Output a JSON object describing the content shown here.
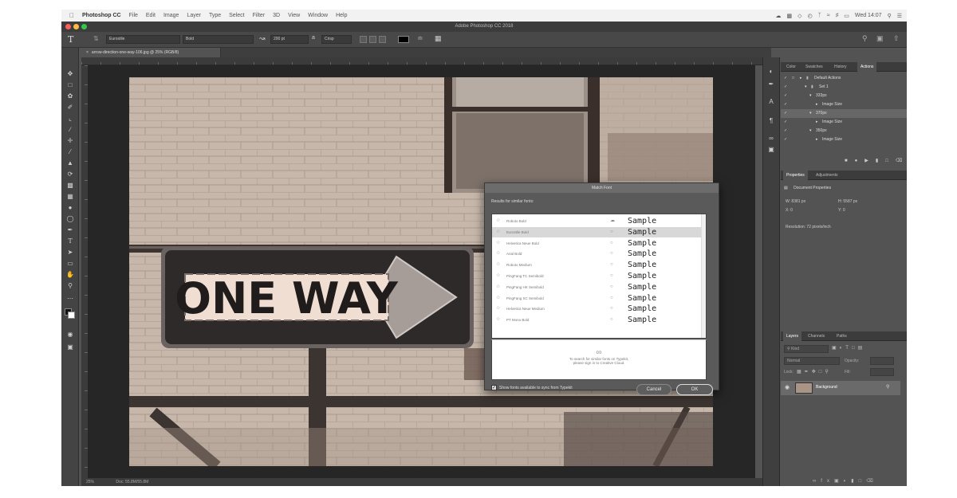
{
  "menubar": {
    "app_name": "Photoshop CC",
    "items": [
      "File",
      "Edit",
      "Image",
      "Layer",
      "Type",
      "Select",
      "Filter",
      "3D",
      "View",
      "Window",
      "Help"
    ],
    "clock": "Wed 14:07"
  },
  "window": {
    "title": "Adobe Photoshop CC 2018"
  },
  "options_bar": {
    "font_family": "Eurostile",
    "font_style": "Bold",
    "font_size": "200 pt",
    "antialias": "Crisp"
  },
  "document": {
    "tab_title": "arrow-direction-one-way-106.jpg @ 25% (RGB/8)",
    "zoom": "25%",
    "doc_size": "Doc: 55.8M/55.8M"
  },
  "photo": {
    "sign_text": "ONE WAY"
  },
  "actions_panel": {
    "tabs": [
      "Color",
      "Swatches",
      "History",
      "Actions"
    ],
    "active_tab": "Actions",
    "rows": [
      "Default Actions",
      "Set 1",
      "333px",
      "Image Size",
      "370px",
      "Image Size",
      "350px",
      "Image Size"
    ]
  },
  "properties_panel": {
    "tabs": [
      "Properties",
      "Adjustments"
    ],
    "section": "Document Properties",
    "w_label": "W:",
    "w_value": "8381 px",
    "h_label": "H:",
    "h_value": "5587 px",
    "x_label": "X:",
    "x_value": "0",
    "y_label": "Y:",
    "y_value": "0",
    "resolution": "Resolution: 72 pixels/inch"
  },
  "layers_panel": {
    "tabs": [
      "Layers",
      "Channels",
      "Paths"
    ],
    "kind": "Kind",
    "blend": "Normal",
    "opacity": "Opacity:",
    "lock": "Lock:",
    "fill": "Fill:",
    "layer_name": "Background"
  },
  "match_font_dialog": {
    "title": "Match Font",
    "subtitle": "Results for similar fonts:",
    "fonts": [
      {
        "name": "Roboto Bold",
        "sample": "Sample"
      },
      {
        "name": "Eurostile Bold",
        "sample": "Sample"
      },
      {
        "name": "Helvetica Neue Bold",
        "sample": "Sample"
      },
      {
        "name": "Arial Bold",
        "sample": "Sample"
      },
      {
        "name": "Roboto Medium",
        "sample": "Sample"
      },
      {
        "name": "PingFang TC Semibold",
        "sample": "Sample"
      },
      {
        "name": "PingFang HK Semibold",
        "sample": "Sample"
      },
      {
        "name": "PingFang SC Semibold",
        "sample": "Sample"
      },
      {
        "name": "Helvetica Neue Medium",
        "sample": "Sample"
      },
      {
        "name": "PT Mono Bold",
        "sample": "Sample"
      }
    ],
    "selected_index": 1,
    "typekit_line1": "To search for similar fonts on Typekit,",
    "typekit_line2": "please sign in to Creative Cloud.",
    "checkbox_label": "Show fonts available to sync from Typekit",
    "cancel_label": "Cancel",
    "ok_label": "OK"
  },
  "colors": {
    "ui_dark": "#535353",
    "dialog": "#5a5a5a",
    "photo_wall": "#c4b5a8"
  }
}
